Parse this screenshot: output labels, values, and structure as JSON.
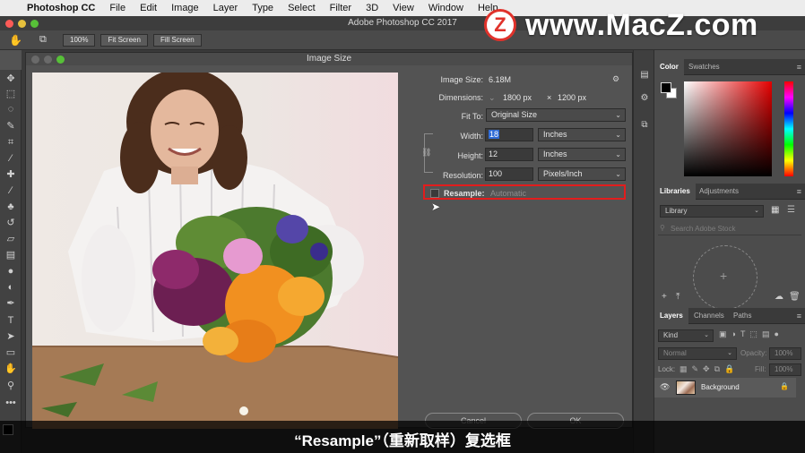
{
  "menubar": {
    "app": "Photoshop CC",
    "items": [
      "File",
      "Edit",
      "Image",
      "Layer",
      "Type",
      "Select",
      "Filter",
      "3D",
      "View",
      "Window",
      "Help"
    ]
  },
  "watermark": {
    "logo": "Z",
    "text": "www.MacZ.com"
  },
  "window": {
    "title": "Adobe Photoshop CC 2017"
  },
  "options_bar": {
    "zoom_label": "100%",
    "fit_screen_label": "Fit Screen",
    "fill_screen_label": "Fill Screen"
  },
  "dialog": {
    "title": "Image Size",
    "image_size_label": "Image Size:",
    "image_size_value": "6.18M",
    "dimensions_label": "Dimensions:",
    "dimensions_w": "1800 px",
    "dimensions_x": "×",
    "dimensions_h": "1200 px",
    "fit_to_label": "Fit To:",
    "fit_to_value": "Original Size",
    "width_label": "Width:",
    "width_value": "18",
    "width_unit": "Inches",
    "height_label": "Height:",
    "height_value": "12",
    "height_unit": "Inches",
    "resolution_label": "Resolution:",
    "resolution_value": "100",
    "resolution_unit": "Pixels/Inch",
    "resample_label": "Resample:",
    "resample_value": "Automatic",
    "cancel_label": "Cancel",
    "ok_label": "OK"
  },
  "panels": {
    "color_tab": "Color",
    "swatches_tab": "Swatches",
    "libraries_tab": "Libraries",
    "adjustments_tab": "Adjustments",
    "library_select": "Library",
    "search_placeholder": "Search Adobe Stock",
    "layers_tab": "Layers",
    "channels_tab": "Channels",
    "paths_tab": "Paths",
    "kind_select": "Kind",
    "blend_mode": "Normal",
    "opacity_label": "Opacity:",
    "opacity_value": "100%",
    "lock_label": "Lock:",
    "fill_label": "Fill:",
    "fill_value": "100%",
    "layer_name": "Background"
  },
  "subtitle": "“Resample”（重新取样）复选框"
}
